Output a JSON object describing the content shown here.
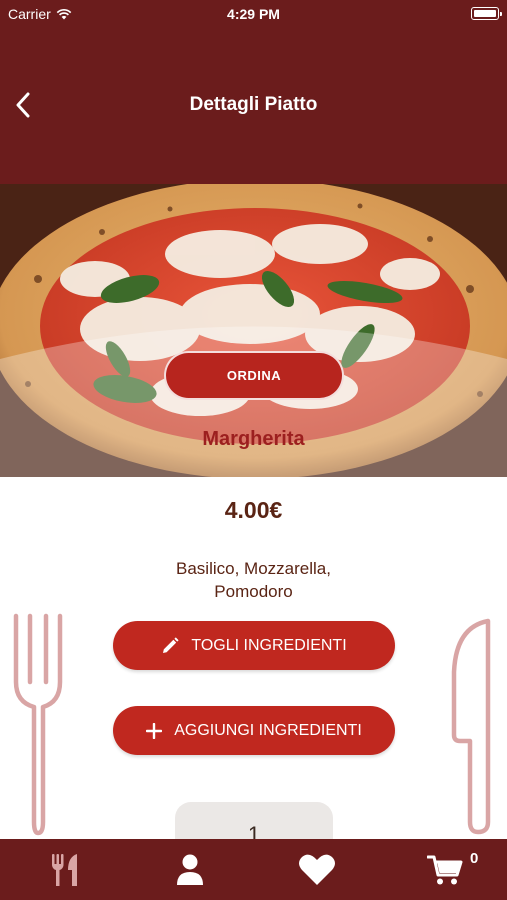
{
  "status_bar": {
    "carrier": "Carrier",
    "time": "4:29 PM"
  },
  "nav": {
    "title": "Dettagli Piatto",
    "back_icon": "chevron-left-icon"
  },
  "dish": {
    "order_label": "ORDINA",
    "name": "Margherita",
    "price": "4.00€",
    "ingredients": "Basilico, Mozzarella, Pomodoro"
  },
  "actions": {
    "remove_label": "TOGLI INGREDIENTI",
    "remove_icon": "pencil-icon",
    "add_label": "AGGIUNGI INGREDIENTI",
    "add_icon": "plus-icon"
  },
  "quantity": {
    "value": "1"
  },
  "tabbar": {
    "items": [
      {
        "icon": "fork-knife-icon"
      },
      {
        "icon": "user-icon"
      },
      {
        "icon": "heart-icon"
      },
      {
        "icon": "cart-icon"
      }
    ],
    "cart_count": "0"
  },
  "colors": {
    "header": "#6b1c1c",
    "accent": "#c0281f",
    "dish_name": "#9c1f1f",
    "text": "#5a2414",
    "cutlery": "#d9a5a5"
  }
}
